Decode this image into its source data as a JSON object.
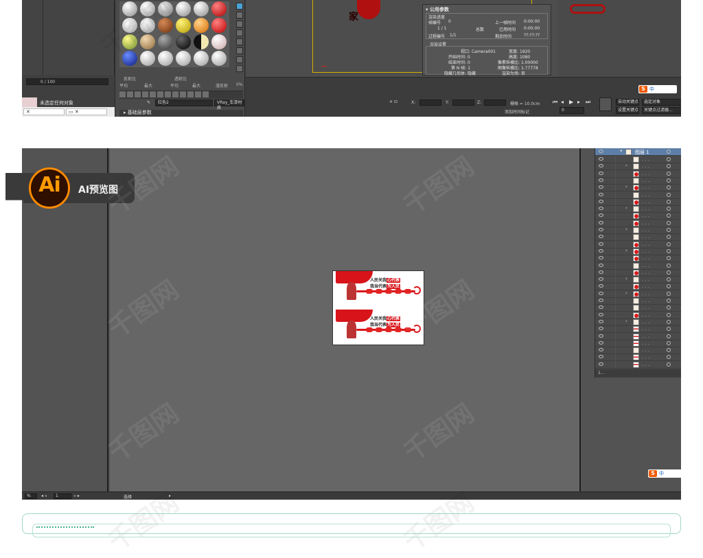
{
  "max_panel": {
    "frame_counter": "0 / 100",
    "status_text": "未选定任何对象",
    "material_params": {
      "reflect_label": "反射比",
      "refract_label": "透射比",
      "col1": "平均",
      "col2": "最大",
      "col3": "平均",
      "col4": "最大",
      "col5": "漫反射",
      "col6": "0%",
      "material_name": "红色2",
      "material_type": "VRay_车漆材质",
      "rollout_title": "基础层参数"
    },
    "render_dialog": {
      "title": "公用参数",
      "progress_header": "渲染进度",
      "frame_label": "帧编号",
      "frame_value": "0",
      "prev_time_label": "上一帧时间",
      "prev_time_value": "0:00:00",
      "ratio": "1 / 1",
      "total_label": "总数",
      "elapsed_label": "已用时间",
      "elapsed_value": "0:00:00",
      "pass_label": "过程编号",
      "pass_value": "1/1",
      "remaining_label": "剩余时间",
      "remaining_value": "??:??:??",
      "settings_header": "渲染设置",
      "viewport_label": "视口",
      "viewport_value": "Camera001",
      "width_label": "宽度",
      "width_value": "1920",
      "start_label": "开始时间",
      "start_value": "0",
      "height_label": "高度",
      "height_value": "1080",
      "end_label": "结束时间",
      "end_value": "0",
      "pixel_ratio_label": "像素纵横比",
      "pixel_ratio_value": "1.00000",
      "nth_label": "第 N 帧",
      "nth_value": "1",
      "image_ratio_label": "图像纵横比",
      "image_ratio_value": "1.77778",
      "hidden_label": "隐藏几何体",
      "hidden_value": "隐藏",
      "render_field_label": "渲染为场",
      "render_field_value": "否"
    },
    "timeline": {
      "x_label": "X:",
      "y_label": "Y:",
      "z_label": "Z:",
      "grid_label": "栅格 = 10.0cm",
      "add_time_tag": "添加时间标记",
      "auto_key": "自动关键点",
      "selected_object": "选定对象",
      "set_key": "设置关键点",
      "key_filter": "关键点过滤器...",
      "frame_field": "0"
    },
    "ime_text": "中"
  },
  "ai_panel": {
    "badge_logo": "Ai",
    "badge_text": "AI预览图",
    "layer_name": "图层 1",
    "layers_footer": "1...",
    "status_select": "选择",
    "zoom_value": "1",
    "artwork": {
      "slogan_line1_prefix": "人民关我",
      "slogan_line1_box": "心代表",
      "slogan_line2_prefix": "我当代表",
      "slogan_line2_box": "为人民"
    },
    "ime_text": "中"
  },
  "watermark_text": "千图网"
}
